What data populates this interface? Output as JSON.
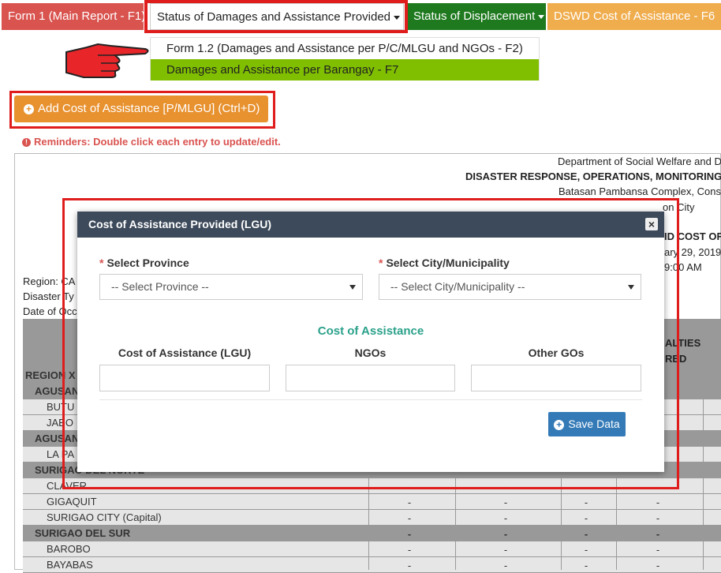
{
  "tabs": {
    "form1": "Form 1 (Main Report - F1)",
    "status": "Status of Damages and Assistance Provided",
    "displacement": "Status of Displacement",
    "dswd": "DSWD Cost of Assistance - F6"
  },
  "dropdown": {
    "item1": "Form 1.2 (Damages and Assistance per P/C/MLGU and NGOs - F2)",
    "item2": "Damages and Assistance per Barangay - F7"
  },
  "add_button": "Add Cost of Assistance [P/MLGU] (Ctrl+D)",
  "reminder": "Reminders: Double click each entry to update/edit.",
  "report": {
    "line1": "Department of Social Welfare and D",
    "line2": "DISASTER RESPONSE, OPERATIONS, MONITORING",
    "line3": "Batasan Pambansa Complex, Cons",
    "line4": "on City",
    "line5": "ID COST OF",
    "line6": "ary 29, 2019",
    "line7": "9:00 AM",
    "region": "Region: CA",
    "disaster": "Disaster Ty",
    "date": "Date of Occ",
    "col_casualties": "ALTIES",
    "col_red": "RED",
    "dash": "-"
  },
  "rows": [
    {
      "label": "REGION X",
      "type": "dark"
    },
    {
      "label": "AGUSAN",
      "type": "dark"
    },
    {
      "label": "BUTU",
      "type": "light"
    },
    {
      "label": "JABO",
      "type": "light"
    },
    {
      "label": "AGUSAN",
      "type": "dark"
    },
    {
      "label": "LA PA",
      "type": "light"
    },
    {
      "label": "SURIGAO DEL NORTE",
      "type": "dark"
    },
    {
      "label": "CLAVER",
      "type": "light"
    },
    {
      "label": "GIGAQUIT",
      "type": "light"
    },
    {
      "label": "SURIGAO CITY (Capital)",
      "type": "light"
    },
    {
      "label": "SURIGAO DEL SUR",
      "type": "dark"
    },
    {
      "label": "BAROBO",
      "type": "light"
    },
    {
      "label": "BAYABAS",
      "type": "light"
    }
  ],
  "modal": {
    "title": "Cost of Assistance Provided (LGU)",
    "close": "×",
    "province_label": "Select Province",
    "province_value": "-- Select Province --",
    "city_label": "Select City/Municipality",
    "city_value": "-- Select City/Municipality --",
    "section_title": "Cost of Assistance",
    "lgu_label": "Cost of Assistance (LGU)",
    "ngo_label": "NGOs",
    "other_label": "Other GOs",
    "save_button": "Save Data",
    "required_mark": "*"
  },
  "colors": {
    "highlight": "#e01d1d",
    "tab_red": "#d9534f",
    "tab_green": "#1f7a1f",
    "tab_orange": "#f0ad4e",
    "dropdown_active": "#7fbf00",
    "modal_header": "#3d4a5b",
    "accent_teal": "#2aa18a",
    "save_blue": "#337ab7"
  },
  "icons": [
    "pointing-hand-icon",
    "plus-circle-icon",
    "info-circle-icon",
    "close-icon",
    "caret-down-icon"
  ]
}
